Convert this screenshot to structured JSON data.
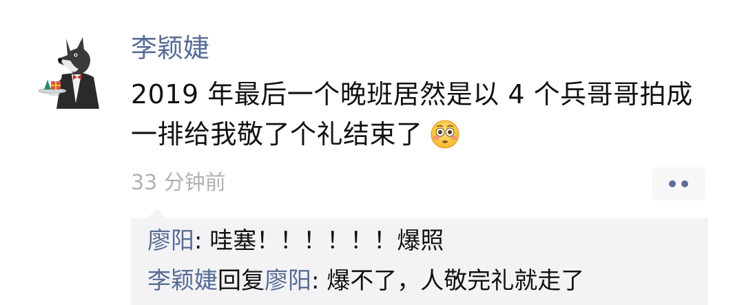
{
  "post": {
    "username": "李颖婕",
    "text": "2019 年最后一个晚班居然是以 4 个兵哥哥拍成一排给我敬了个礼结束了",
    "emoji": "flushed-face-emoji",
    "time": "33 分钟前"
  },
  "comments": [
    {
      "author": "廖阳",
      "separator": ": ",
      "text": "哇塞！！！！！！爆照"
    },
    {
      "author": "李颖婕",
      "reply_word": "回复",
      "reply_to": "廖阳",
      "separator": ": ",
      "text": "爆不了，人敬完礼就走了"
    }
  ],
  "colors": {
    "link": "#576b95",
    "text": "#111111",
    "time": "#b2b2b2",
    "comment_bg": "#f3f3f5"
  }
}
